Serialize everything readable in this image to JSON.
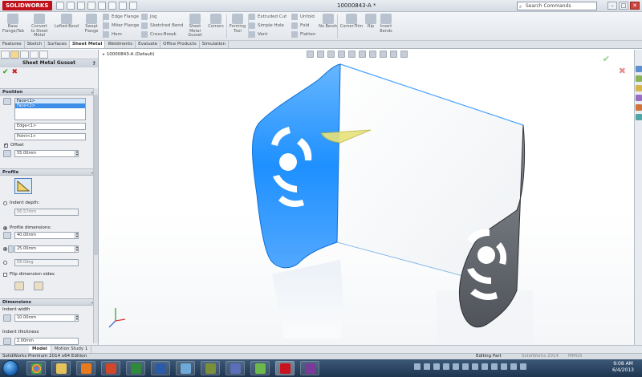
{
  "app": {
    "logo_text": "SOLIDWORKS",
    "document_title": "10000843-A *",
    "search_placeholder": "Search Commands",
    "window_controls": [
      "–",
      "□",
      "✕"
    ]
  },
  "ribbon": {
    "big_buttons": [
      {
        "label": "Base Flange/Tab",
        "icon": "base-flange-icon"
      },
      {
        "label": "Convert to Sheet Metal",
        "icon": "convert-sheet-metal-icon"
      },
      {
        "label": "Lofted-Bend",
        "icon": "lofted-bend-icon"
      },
      {
        "label": "Swept Flange",
        "icon": "swept-flange-icon"
      },
      {
        "label": "Sheet Metal Gusset",
        "icon": "gusset-icon"
      },
      {
        "label": "Corners",
        "icon": "corners-icon"
      },
      {
        "label": "Forming Tool",
        "icon": "forming-tool-icon"
      },
      {
        "label": "No Bends",
        "icon": "no-bends-icon"
      },
      {
        "label": "Corner-Trim",
        "icon": "corner-trim-icon"
      },
      {
        "label": "Rip",
        "icon": "rip-icon"
      },
      {
        "label": "Insert Bends",
        "icon": "insert-bends-icon"
      }
    ],
    "small_buttons": [
      {
        "label": "Edge Flange"
      },
      {
        "label": "Miter Flange"
      },
      {
        "label": "Hem"
      },
      {
        "label": "Jog"
      },
      {
        "label": "Sketched Bend"
      },
      {
        "label": "Cross-Break"
      },
      {
        "label": "Extruded Cut"
      },
      {
        "label": "Simple Hole"
      },
      {
        "label": "Vent"
      },
      {
        "label": "Unfold"
      },
      {
        "label": "Fold"
      },
      {
        "label": "Flatten"
      }
    ]
  },
  "tabs": [
    "Features",
    "Sketch",
    "Surfaces",
    "Sheet Metal",
    "Weldments",
    "Evaluate",
    "Office Products",
    "Simulation"
  ],
  "active_tab": "Sheet Metal",
  "property_manager": {
    "title": "Sheet Metal Gusset",
    "help": "?",
    "ok": "✔",
    "cancel": "✖",
    "position": {
      "header": "Position",
      "faces": [
        "Face<1>",
        "Face<2>"
      ],
      "edge": "Edge<1>",
      "point": "Point<1>",
      "offset_label": "Offset",
      "offset_value": "55.00mm"
    },
    "profile": {
      "header": "Profile",
      "indent_depth_label": "Indent depth:",
      "indent_depth_value": "56.57mm",
      "profile_dimensions_label": "Profile dimensions:",
      "dim1": "40.00mm",
      "dim2": "25.00mm",
      "angle": "58.0deg",
      "flip_label": "Flip dimension sides"
    },
    "dimensions": {
      "header": "Dimensions",
      "indent_width_label": "Indent width",
      "indent_width_value": "10.00mm",
      "indent_thickness_label": "Indent thickness",
      "indent_thickness_value": "2.00mm"
    }
  },
  "viewport": {
    "tree_label": "10000843-A  (Default)",
    "ok": "✔",
    "cancel": "✖"
  },
  "bottom_tabs": [
    "Model",
    "Motion Study 1"
  ],
  "status": {
    "left": "SolidWorks Premium 2014 x64 Edition",
    "mode": "Editing Part",
    "version": "SolidWorks 2014",
    "units": "MMGS"
  },
  "taskbar": {
    "time": "9:08 AM",
    "date": "6/4/2013"
  },
  "colors": {
    "selection_blue": "#1e90ff",
    "gusset_yellow": "#e8e27a",
    "part_gray": "#6f7378"
  }
}
